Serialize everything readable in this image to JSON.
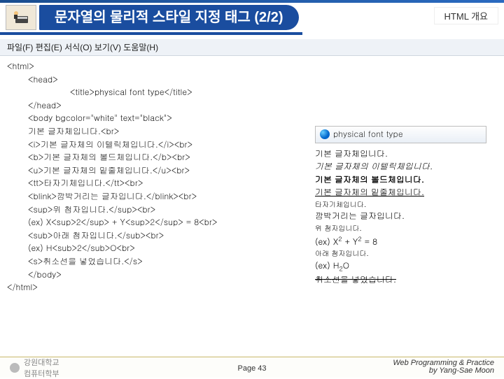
{
  "header": {
    "title": "문자열의 물리적 스타일 지정 태그 (2/2)",
    "icon_name": "typing-icon",
    "top_right": "HTML 개요"
  },
  "menu": "파일(F)   편집(E)   서식(O)   보기(V)   도움말(H)",
  "code": {
    "l1": "<html>",
    "l2": "<head>",
    "l3": "<title>physical font type</title>",
    "l4": "</head>",
    "l5": "<body bgcolor=\"white\" text=\"black\">",
    "l6": "기본 글자체입니다.<br>",
    "l7": "<i>기본 글자체의 이텔릭체입니다.</i><br>",
    "l8": "<b>기본 글자체의 볼드체입니다.</b><br>",
    "l9": "<u>기본 글자체의 밑줄체입니다.</u><br>",
    "l10": "<tt>타자기체입니다.</tt><br>",
    "l11": "<blink>깜박거리는 글자입니다.</blink><br>",
    "l12": "<sup>위 첨자입니다.</sup><br>",
    "l13": "(ex) X<sup>2</sup> + Y<sup>2</sup> = 8<br>",
    "l14": "<sub>아래 첨자입니다.</sub><br>",
    "l15": "(ex) H<sub>2</sub>O<br>",
    "l16": "<s>취소선을 넣었습니다.</s>",
    "l17": "</body>",
    "l18": "</html>"
  },
  "result": {
    "tab_label": "physical font type",
    "r1": "기본 글자체입니다.",
    "r2": "기본 글자체의 이텔릭체입니다.",
    "r3": "기본 글자체의 볼드체입니다.",
    "r4": "기본 글자체의 밑줄체입니다.",
    "r5": "타자기체입니다.",
    "r6": "깜박거리는 글자입니다.",
    "r7": "위 첨자입니다.",
    "r8a": "(ex) X",
    "r8b": "2",
    "r8c": " + Y",
    "r8d": "2",
    "r8e": " = 8",
    "r9": "아래 첨자입니다.",
    "r10a": "(ex) H",
    "r10b": "2",
    "r10c": "O",
    "r11": "취소선을 넣었습니다."
  },
  "footer": {
    "logo_text": "강원대학교\n컴퓨터학부",
    "page": "Page 43",
    "right1": "Web Programming & Practice",
    "right2": "by Yang-Sae Moon"
  }
}
